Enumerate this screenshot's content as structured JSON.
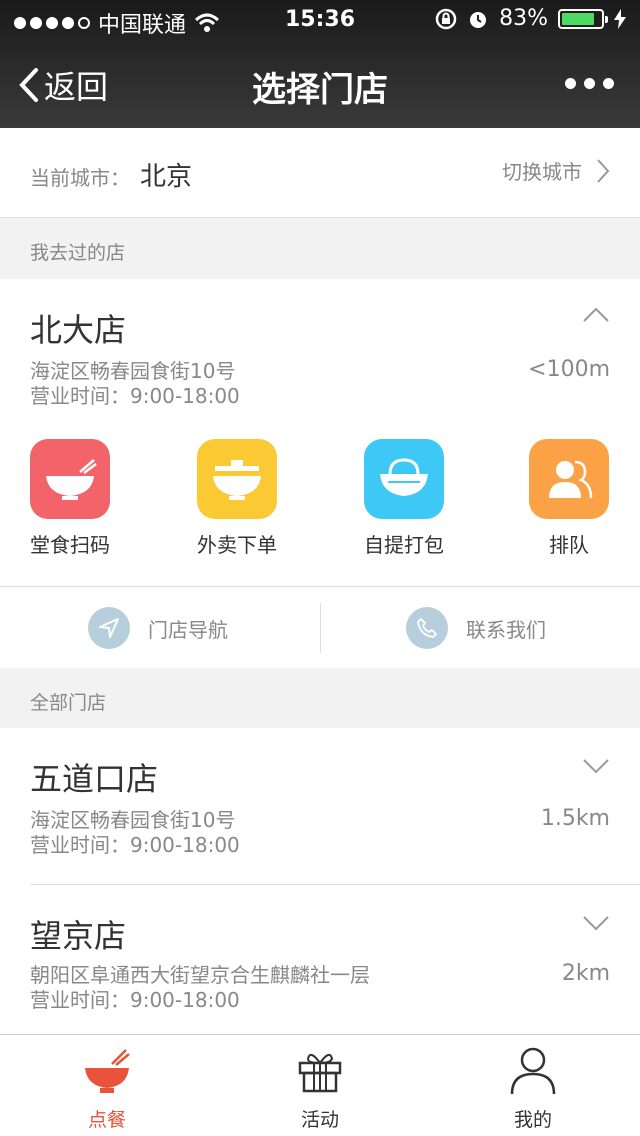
{
  "status": {
    "carrier": "中国联通",
    "time": "15:36",
    "battery_pct": "83%",
    "battery_fill": 0.83
  },
  "nav": {
    "back_label": "返回",
    "title": "选择门店"
  },
  "city": {
    "label": "当前城市：",
    "value": "北京",
    "switch_label": "切换城市"
  },
  "visited": {
    "section_title": "我去过的店",
    "store": {
      "name": "北大店",
      "address": "海淀区畅春园食街10号",
      "hours": "营业时间：9:00-18:00",
      "distance": "<100m"
    },
    "features": [
      {
        "label": "堂食扫码",
        "color": "#f2636a"
      },
      {
        "label": "外卖下单",
        "color": "#fbc934"
      },
      {
        "label": "自提打包",
        "color": "#3ec8f6"
      },
      {
        "label": "排队",
        "color": "#fca246"
      }
    ],
    "actions": {
      "navigate": "门店导航",
      "contact": "联系我们"
    }
  },
  "all": {
    "section_title": "全部门店",
    "stores": [
      {
        "name": "五道口店",
        "address": "海淀区畅春园食街10号",
        "hours": "营业时间：9:00-18:00",
        "distance": "1.5km"
      },
      {
        "name": "望京店",
        "address": "朝阳区阜通西大街望京合生麒麟社一层",
        "hours": "营业时间：9:00-18:00",
        "distance": "2km"
      }
    ]
  },
  "tabs": [
    {
      "label": "点餐",
      "icon": "bowl-icon",
      "active": true
    },
    {
      "label": "活动",
      "icon": "gift-icon",
      "active": false
    },
    {
      "label": "我的",
      "icon": "person-icon",
      "active": false
    }
  ],
  "colors": {
    "accent": "#e8533a",
    "text_gray": "#888888"
  }
}
